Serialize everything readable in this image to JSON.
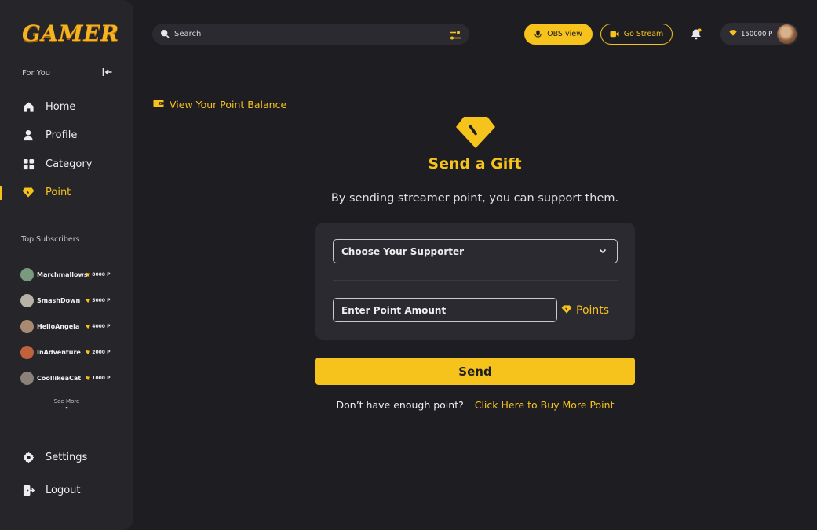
{
  "brand": {
    "logo_text": "GAMER",
    "accent": "#f6c21c"
  },
  "sidebar": {
    "section_title": "For You",
    "items": [
      {
        "label": "Home",
        "icon": "home-icon"
      },
      {
        "label": "Profile",
        "icon": "user-icon"
      },
      {
        "label": "Category",
        "icon": "grid-icon"
      },
      {
        "label": "Point",
        "icon": "gem-icon",
        "active": true
      }
    ],
    "top_subscribers_title": "Top Subscribers",
    "subscribers": [
      {
        "name": "Marchmallows",
        "points": "8000 P",
        "color": "#7a9a7e"
      },
      {
        "name": "SmashDown",
        "points": "5000 P",
        "color": "#b9b2a6"
      },
      {
        "name": "HelloAngela",
        "points": "4000 P",
        "color": "#a88a70"
      },
      {
        "name": "InAdventure",
        "points": "2000 P",
        "color": "#c0623b"
      },
      {
        "name": "CoollikeaCat",
        "points": "1000 P",
        "color": "#8a8278"
      }
    ],
    "see_more": "See More",
    "bottom_items": [
      {
        "label": "Settings",
        "icon": "gear-icon"
      },
      {
        "label": "Logout",
        "icon": "logout-icon"
      }
    ]
  },
  "topbar": {
    "search_placeholder": "Search",
    "obs_label": "OBS view",
    "go_stream_label": "Go Stream",
    "balance": "150000 P"
  },
  "main": {
    "view_balance_label": "View Your Point Balance",
    "title": "Send a Gift",
    "subtitle": "By sending streamer point, you can support them.",
    "supporter_select": "Choose Your Supporter",
    "amount_placeholder": "Enter Point Amount",
    "points_label": "Points",
    "send_label": "Send",
    "not_enough": "Don’t have enough point?",
    "buy_link": "Click Here to Buy More Point"
  }
}
